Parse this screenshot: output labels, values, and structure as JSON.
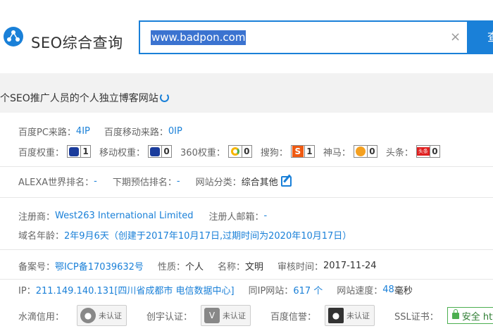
{
  "header": {
    "title": "SEO综合查询",
    "search_value": "www.badpon.com",
    "clear_glyph": "×",
    "search_button": "查"
  },
  "tagline": "个SEO推广人员的个人独立博客网站",
  "traffic": {
    "pc_label": "百度PC来路：",
    "pc_value": "4IP",
    "mobile_label": "百度移动来路：",
    "mobile_value": "0IP"
  },
  "weights": [
    {
      "label": "百度权重：",
      "icon": "baidu-paw-icon",
      "value": "1"
    },
    {
      "label": "移动权重：",
      "icon": "baidu-paw-icon",
      "value": "0"
    },
    {
      "label": "360权重：",
      "icon": "360-icon",
      "value": "0"
    },
    {
      "label": "搜狗：",
      "icon": "sogou-icon",
      "value": "1"
    },
    {
      "label": "神马：",
      "icon": "shenma-icon",
      "value": "0"
    },
    {
      "label": "头条：",
      "icon": "toutiao-icon",
      "value": "0"
    }
  ],
  "sogou_glyph": "S",
  "toutiao_glyph": "头条",
  "alexa": {
    "rank_label": "ALEXA世界排名：",
    "rank_value": "-",
    "next_label": "下期预估排名：",
    "next_value": "-",
    "category_label": "网站分类：",
    "category_value": "综合其他"
  },
  "whois": {
    "registrar_label": "注册商：",
    "registrar_value": "West263 International Limited",
    "email_label": "注册人邮箱：",
    "email_value": "-",
    "age_label": "域名年龄：",
    "age_value": "2年9月6天（创建于2017年10月17日,过期时间为2020年10月17日）"
  },
  "icp": {
    "number_label": "备案号：",
    "number_value": "鄂ICP备17039632号",
    "nature_label": "性质：",
    "nature_value": "个人",
    "name_label": "名称：",
    "name_value": "文明",
    "audit_label": "审核时间：",
    "audit_value": "2017-11-24"
  },
  "ip": {
    "ip_label": "IP：",
    "ip_value": "211.149.140.131[四川省成都市 电信数据中心]",
    "same_label": "同IP网站：",
    "same_value": "617 个",
    "speed_label": "网站速度：",
    "speed_value": "48",
    "speed_unit": " 毫秒"
  },
  "credit": {
    "shuidi_label": "水滴信用：",
    "shuidi_status": "未认证",
    "chuangyu_label": "创宇认证：",
    "chuangyu_status": "未认证",
    "baidu_label": "百度信誉：",
    "baidu_status": "未认证",
    "ssl_label": "SSL证书：",
    "ssl_value": "安全 http"
  }
}
